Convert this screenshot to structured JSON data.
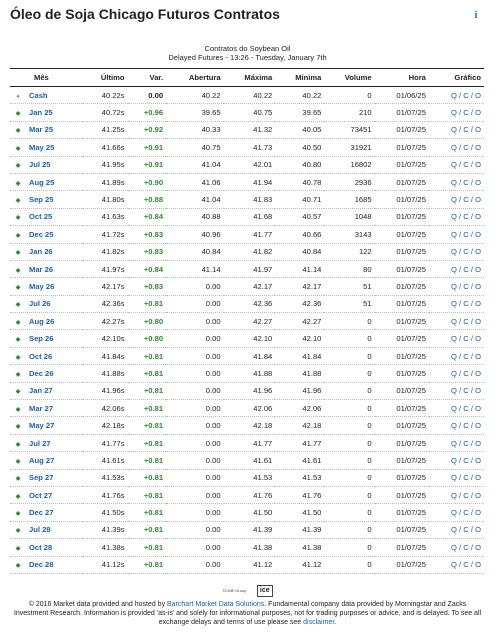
{
  "page": {
    "title": "Óleo de Soja Chicago Futuros Contratos",
    "info_icon": "info-icon",
    "info_glyph": "i"
  },
  "subhead": {
    "line1": "Contratos do Soybean Oil",
    "line2": "Delayed Futures - 13:26 - Tuesday, January 7th"
  },
  "columns": [
    "Mês",
    "Último",
    "Var.",
    "Abertura",
    "Máxima",
    "Mínima",
    "Volume",
    "Hora",
    "Gráfico"
  ],
  "rows": [
    {
      "mes": "Cash",
      "ultimo": "40.22s",
      "var": "0.00",
      "abertura": "40.22",
      "maxima": "40.22",
      "minima": "40.22",
      "volume": "0",
      "hora": "01/06/25",
      "dir": "flat"
    },
    {
      "mes": "Jan 25",
      "ultimo": "40.72s",
      "var": "+0.96",
      "abertura": "39.65",
      "maxima": "40.75",
      "minima": "39.65",
      "volume": "210",
      "hora": "01/07/25",
      "dir": "up"
    },
    {
      "mes": "Mar 25",
      "ultimo": "41.25s",
      "var": "+0.92",
      "abertura": "40.33",
      "maxima": "41.32",
      "minima": "40.05",
      "volume": "73451",
      "hora": "01/07/25",
      "dir": "up"
    },
    {
      "mes": "May 25",
      "ultimo": "41.66s",
      "var": "+0.91",
      "abertura": "40.75",
      "maxima": "41.73",
      "minima": "40.50",
      "volume": "31921",
      "hora": "01/07/25",
      "dir": "up"
    },
    {
      "mes": "Jul 25",
      "ultimo": "41.95s",
      "var": "+0.91",
      "abertura": "41.04",
      "maxima": "42.01",
      "minima": "40.80",
      "volume": "16802",
      "hora": "01/07/25",
      "dir": "up"
    },
    {
      "mes": "Aug 25",
      "ultimo": "41.89s",
      "var": "+0.90",
      "abertura": "41.06",
      "maxima": "41.94",
      "minima": "40.78",
      "volume": "2936",
      "hora": "01/07/25",
      "dir": "up"
    },
    {
      "mes": "Sep 25",
      "ultimo": "41.80s",
      "var": "+0.88",
      "abertura": "41.04",
      "maxima": "41.83",
      "minima": "40.71",
      "volume": "1685",
      "hora": "01/07/25",
      "dir": "up"
    },
    {
      "mes": "Oct 25",
      "ultimo": "41.63s",
      "var": "+0.84",
      "abertura": "40.88",
      "maxima": "41.68",
      "minima": "40.57",
      "volume": "1048",
      "hora": "01/07/25",
      "dir": "up"
    },
    {
      "mes": "Dec 25",
      "ultimo": "41.72s",
      "var": "+0.83",
      "abertura": "40.96",
      "maxima": "41.77",
      "minima": "40.66",
      "volume": "3143",
      "hora": "01/07/25",
      "dir": "up"
    },
    {
      "mes": "Jan 26",
      "ultimo": "41.82s",
      "var": "+0.83",
      "abertura": "40.84",
      "maxima": "41.82",
      "minima": "40.84",
      "volume": "122",
      "hora": "01/07/25",
      "dir": "up"
    },
    {
      "mes": "Mar 26",
      "ultimo": "41.97s",
      "var": "+0.84",
      "abertura": "41.14",
      "maxima": "41.97",
      "minima": "41.14",
      "volume": "80",
      "hora": "01/07/25",
      "dir": "up"
    },
    {
      "mes": "May 26",
      "ultimo": "42.17s",
      "var": "+0.83",
      "abertura": "0.00",
      "maxima": "42.17",
      "minima": "42.17",
      "volume": "51",
      "hora": "01/07/25",
      "dir": "up"
    },
    {
      "mes": "Jul 26",
      "ultimo": "42.36s",
      "var": "+0.81",
      "abertura": "0.00",
      "maxima": "42.36",
      "minima": "42.36",
      "volume": "51",
      "hora": "01/07/25",
      "dir": "up"
    },
    {
      "mes": "Aug 26",
      "ultimo": "42.27s",
      "var": "+0.80",
      "abertura": "0.00",
      "maxima": "42.27",
      "minima": "42.27",
      "volume": "0",
      "hora": "01/07/25",
      "dir": "up"
    },
    {
      "mes": "Sep 26",
      "ultimo": "42.10s",
      "var": "+0.80",
      "abertura": "0.00",
      "maxima": "42.10",
      "minima": "42.10",
      "volume": "0",
      "hora": "01/07/25",
      "dir": "up"
    },
    {
      "mes": "Oct 26",
      "ultimo": "41.84s",
      "var": "+0.81",
      "abertura": "0.00",
      "maxima": "41.84",
      "minima": "41.84",
      "volume": "0",
      "hora": "01/07/25",
      "dir": "up"
    },
    {
      "mes": "Dec 26",
      "ultimo": "41.88s",
      "var": "+0.81",
      "abertura": "0.00",
      "maxima": "41.88",
      "minima": "41.88",
      "volume": "0",
      "hora": "01/07/25",
      "dir": "up"
    },
    {
      "mes": "Jan 27",
      "ultimo": "41.96s",
      "var": "+0.81",
      "abertura": "0.00",
      "maxima": "41.96",
      "minima": "41.96",
      "volume": "0",
      "hora": "01/07/25",
      "dir": "up"
    },
    {
      "mes": "Mar 27",
      "ultimo": "42.06s",
      "var": "+0.81",
      "abertura": "0.00",
      "maxima": "42.06",
      "minima": "42.06",
      "volume": "0",
      "hora": "01/07/25",
      "dir": "up"
    },
    {
      "mes": "May 27",
      "ultimo": "42.18s",
      "var": "+0.81",
      "abertura": "0.00",
      "maxima": "42.18",
      "minima": "42.18",
      "volume": "0",
      "hora": "01/07/25",
      "dir": "up"
    },
    {
      "mes": "Jul 27",
      "ultimo": "41.77s",
      "var": "+0.81",
      "abertura": "0.00",
      "maxima": "41.77",
      "minima": "41.77",
      "volume": "0",
      "hora": "01/07/25",
      "dir": "up"
    },
    {
      "mes": "Aug 27",
      "ultimo": "41.61s",
      "var": "+0.81",
      "abertura": "0.00",
      "maxima": "41.61",
      "minima": "41.61",
      "volume": "0",
      "hora": "01/07/25",
      "dir": "up"
    },
    {
      "mes": "Sep 27",
      "ultimo": "41.53s",
      "var": "+0.81",
      "abertura": "0.00",
      "maxima": "41.53",
      "minima": "41.53",
      "volume": "0",
      "hora": "01/07/25",
      "dir": "up"
    },
    {
      "mes": "Oct 27",
      "ultimo": "41.76s",
      "var": "+0.81",
      "abertura": "0.00",
      "maxima": "41.76",
      "minima": "41.76",
      "volume": "0",
      "hora": "01/07/25",
      "dir": "up"
    },
    {
      "mes": "Dec 27",
      "ultimo": "41.50s",
      "var": "+0.81",
      "abertura": "0.00",
      "maxima": "41.50",
      "minima": "41.50",
      "volume": "0",
      "hora": "01/07/25",
      "dir": "up"
    },
    {
      "mes": "Jul 28",
      "ultimo": "41.39s",
      "var": "+0.81",
      "abertura": "0.00",
      "maxima": "41.39",
      "minima": "41.39",
      "volume": "0",
      "hora": "01/07/25",
      "dir": "up"
    },
    {
      "mes": "Oct 28",
      "ultimo": "41.38s",
      "var": "+0.81",
      "abertura": "0.00",
      "maxima": "41.38",
      "minima": "41.38",
      "volume": "0",
      "hora": "01/07/25",
      "dir": "up"
    },
    {
      "mes": "Dec 28",
      "ultimo": "41.12s",
      "var": "+0.81",
      "abertura": "0.00",
      "maxima": "41.12",
      "minima": "41.12",
      "volume": "0",
      "hora": "01/07/25",
      "dir": "up"
    }
  ],
  "chart_links": {
    "q": "Q",
    "c": "C",
    "o": "O",
    "sep": " / "
  },
  "markers": {
    "up": "◆",
    "flat": "●"
  },
  "colors": {
    "up": "#2e8b2e",
    "link": "#1a5fb4",
    "flat": "#888888"
  },
  "logos": {
    "cme": "©CME Group",
    "ice": "ice"
  },
  "footer": {
    "t1": "© 2016 Market data provided and hosted by ",
    "link1": "Barchart Market Data Solutions",
    "t2": ". Fundamental company data provided by Morningstar and Zacks Investment Research. Information is provided 'as-is' and solely for informational purposes, not for trading purposes or advice, and is delayed. To see all exchange delays and terms of use please see ",
    "link2": "disclaimer",
    "t3": "."
  }
}
